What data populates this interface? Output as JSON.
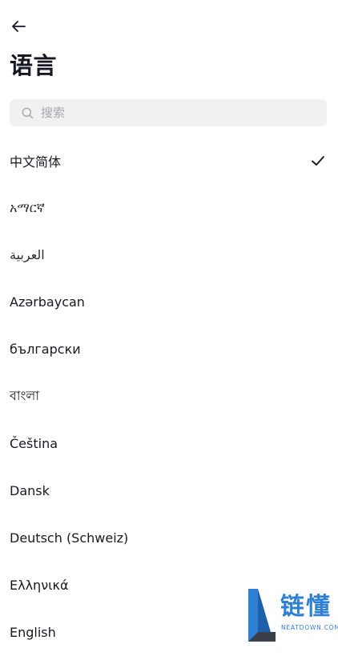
{
  "header": {
    "back_icon": "arrow-left-icon",
    "title": "语言"
  },
  "search": {
    "icon": "search-icon",
    "placeholder": "搜索",
    "value": ""
  },
  "languages": {
    "items": [
      {
        "label": "中文简体",
        "selected": true
      },
      {
        "label": "አማርኛ",
        "selected": false
      },
      {
        "label": "العربية",
        "selected": false
      },
      {
        "label": "Azərbaycan",
        "selected": false
      },
      {
        "label": "български",
        "selected": false
      },
      {
        "label": "বাংলা",
        "selected": false
      },
      {
        "label": "Čeština",
        "selected": false
      },
      {
        "label": "Dansk",
        "selected": false
      },
      {
        "label": "Deutsch (Schweiz)",
        "selected": false
      },
      {
        "label": "Ελληνικά",
        "selected": false
      },
      {
        "label": "English",
        "selected": false
      }
    ],
    "selected_icon": "checkmark-icon"
  },
  "watermark": {
    "text": "链懂",
    "subtext": "NEATDOWN.COM"
  },
  "colors": {
    "text_primary": "#161823",
    "search_bg": "#f1f1f2",
    "placeholder": "#a6a7ab",
    "watermark_blue": "#2f7fd3"
  }
}
